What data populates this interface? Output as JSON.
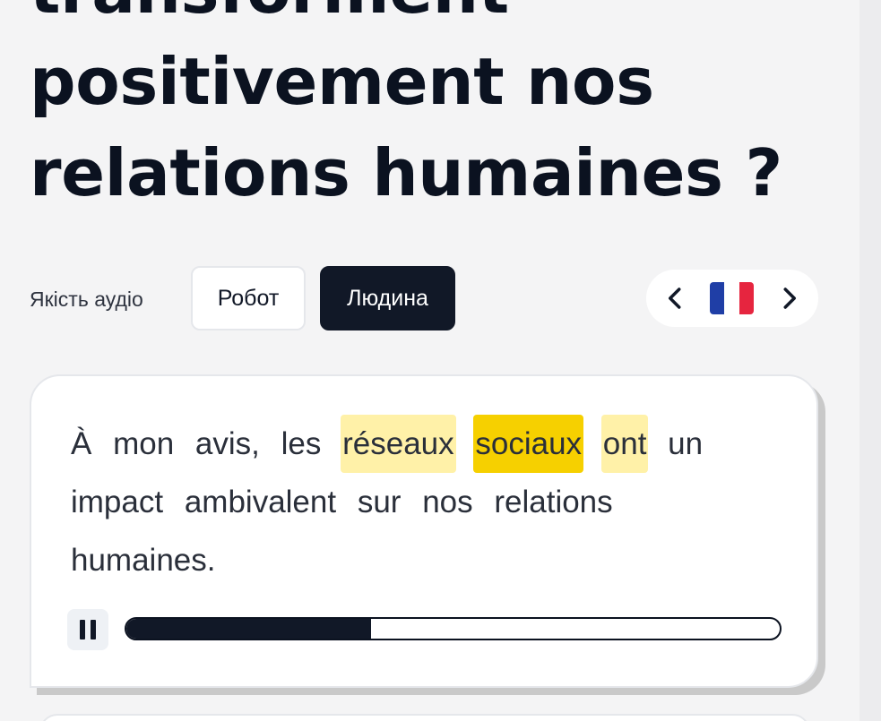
{
  "heading": {
    "line1": "transforment",
    "line2": "positivement nos",
    "line3": "relations humaines ?"
  },
  "audio_quality": {
    "label": "Якість аудіо",
    "robot_label": "Робот",
    "human_label": "Людина",
    "selected": "Людина"
  },
  "language_switcher": {
    "flag_colors": [
      "#1f3ea6",
      "#ffffff",
      "#e6253f"
    ],
    "flag_icon": "france-flag-icon"
  },
  "transcript": {
    "words": [
      {
        "text": "À",
        "highlight": "none"
      },
      {
        "text": "mon",
        "highlight": "none"
      },
      {
        "text": "avis,",
        "highlight": "none"
      },
      {
        "text": "les",
        "highlight": "none"
      },
      {
        "text": "réseaux",
        "highlight": "light"
      },
      {
        "text": "sociaux",
        "highlight": "strong"
      },
      {
        "text": "ont",
        "highlight": "light"
      },
      {
        "text": "un",
        "highlight": "none"
      },
      {
        "text": "impact",
        "highlight": "none"
      },
      {
        "text": "ambivalent",
        "highlight": "none"
      },
      {
        "text": "sur",
        "highlight": "none"
      },
      {
        "text": "nos",
        "highlight": "none"
      },
      {
        "text": "relations",
        "highlight": "none"
      },
      {
        "text": "humaines.",
        "highlight": "none"
      }
    ]
  },
  "player": {
    "state_icon": "pause-icon",
    "progress_percent": 37.5,
    "accent": "#111827"
  }
}
